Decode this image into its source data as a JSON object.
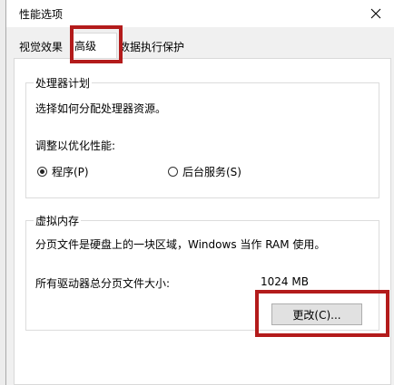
{
  "dialog": {
    "title": "性能选项",
    "close_glyph": "✕"
  },
  "tabs": [
    {
      "label": "视觉效果",
      "active": false
    },
    {
      "label": "高级",
      "active": true
    },
    {
      "label": "数据执行保护",
      "active": false
    }
  ],
  "processor": {
    "group_title": "处理器计划",
    "description": "选择如何分配处理器资源。",
    "optimize_label": "调整以优化性能:",
    "options": [
      {
        "label": "程序(P)",
        "checked": true
      },
      {
        "label": "后台服务(S)",
        "checked": false
      }
    ]
  },
  "virtual_memory": {
    "group_title": "虚拟内存",
    "description": "分页文件是硬盘上的一块区域，Windows 当作 RAM 使用。",
    "total_label": "所有驱动器总分页文件大小:",
    "total_value": "1024 MB",
    "change_button": "更改(C)..."
  },
  "annotation": {
    "highlight_color": "#b31b1b"
  }
}
